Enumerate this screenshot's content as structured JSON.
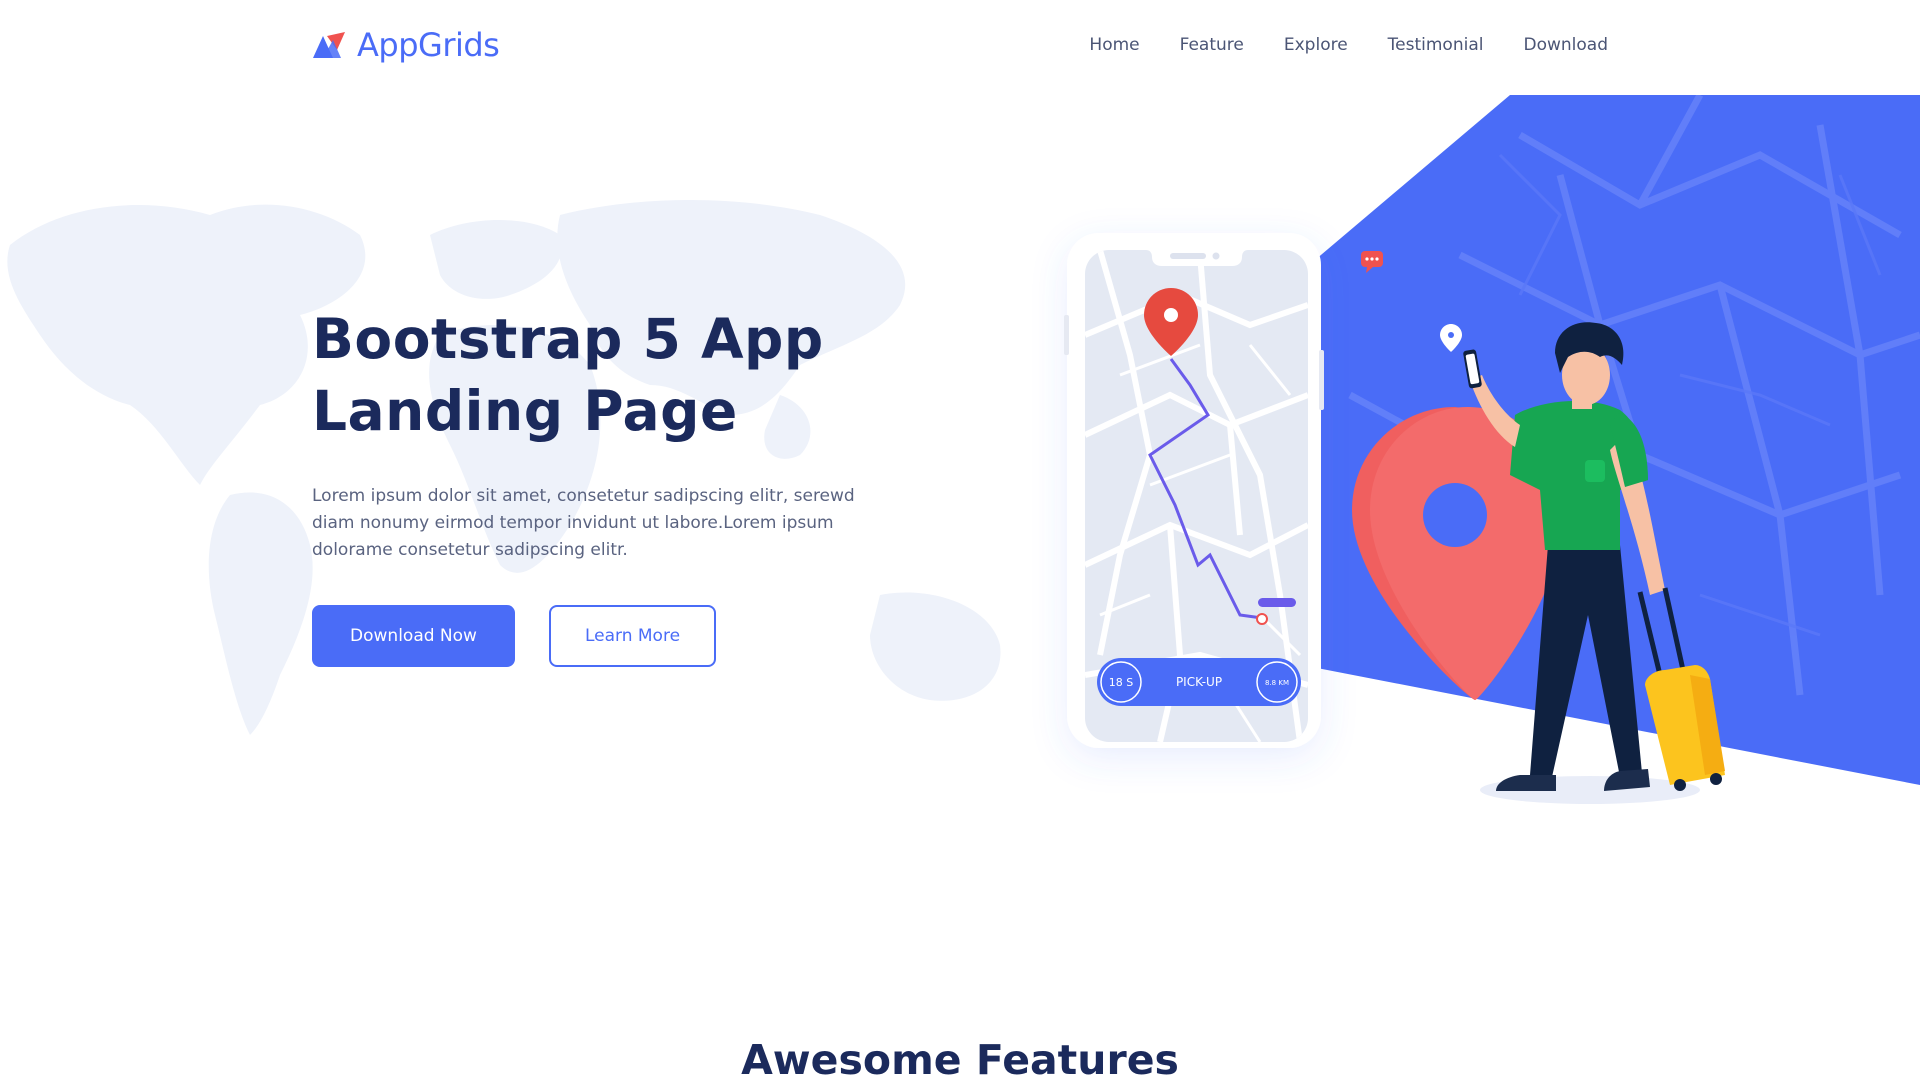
{
  "brand": {
    "name": "AppGrids",
    "accent": "#4a6cf7",
    "logo_secondary": "#f0524f"
  },
  "nav": {
    "items": [
      {
        "label": "Home"
      },
      {
        "label": "Feature"
      },
      {
        "label": "Explore"
      },
      {
        "label": "Testimonial"
      },
      {
        "label": "Download"
      }
    ]
  },
  "hero": {
    "title": "Bootstrap 5 App Landing Page",
    "description": "Lorem ipsum dolor sit amet, consetetur sadipscing elitr, serewd diam nonumy eirmod tempor invidunt ut labore.Lorem ipsum dolorame consetetur sadipscing elitr.",
    "primary_button": "Download Now",
    "secondary_button": "Learn More"
  },
  "phone": {
    "left_badge": "18 S",
    "center_label": "PICK-UP",
    "right_badge": "8.8 KM"
  },
  "features": {
    "title": "Awesome Features"
  },
  "colors": {
    "title": "#1b2a5c",
    "body_text": "#5a6380",
    "map_blue": "#4a6cf7",
    "pin_red": "#f26b6b",
    "shirt_green": "#1aa653",
    "suitcase_yellow": "#fcc41e"
  },
  "icons": [
    "logo-icon",
    "location-pin-icon",
    "chat-bubble-icon",
    "world-map-icon"
  ]
}
